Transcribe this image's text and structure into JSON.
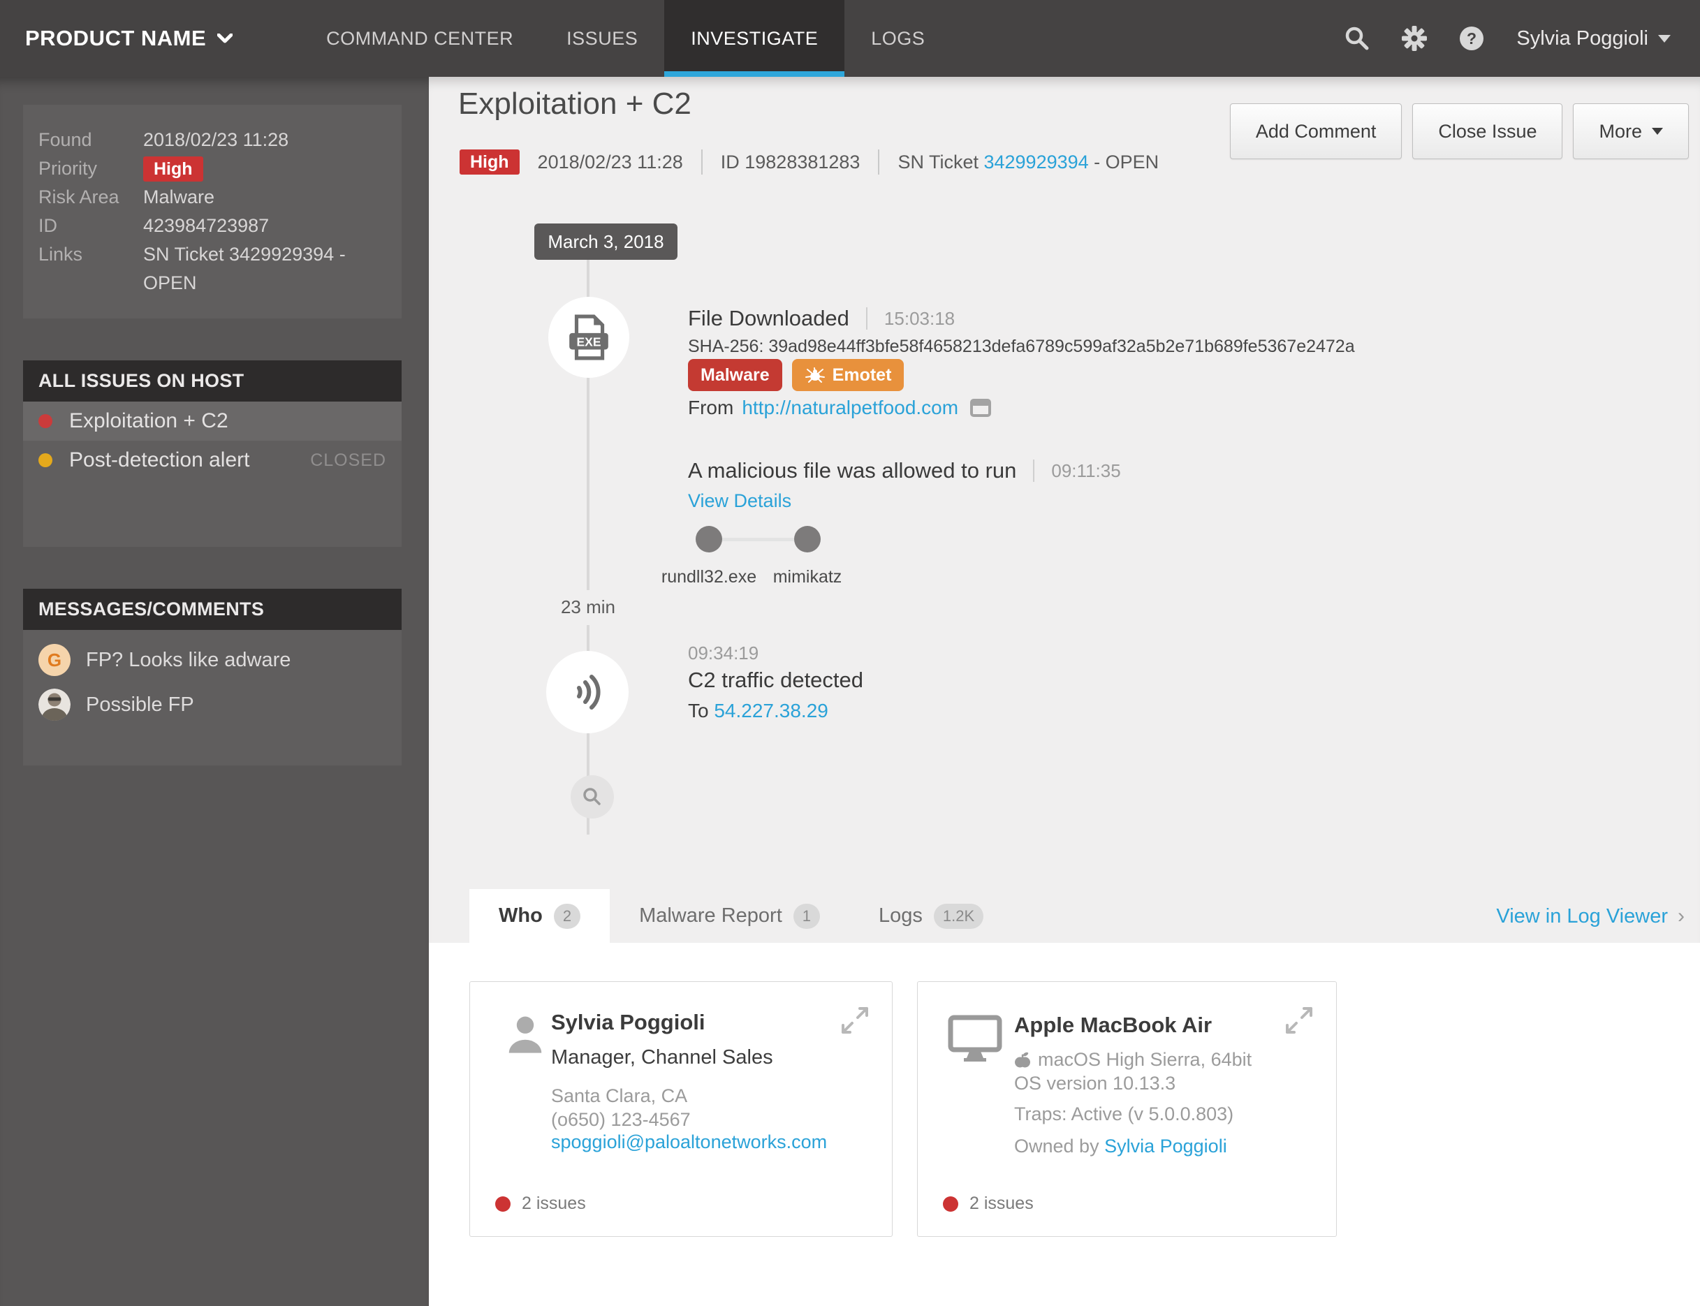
{
  "navbar": {
    "product_name": "PRODUCT NAME",
    "items": [
      {
        "label": "COMMAND CENTER"
      },
      {
        "label": "ISSUES"
      },
      {
        "label": "INVESTIGATE"
      },
      {
        "label": "LOGS"
      }
    ],
    "user_name": "Sylvia Poggioli"
  },
  "sidebar": {
    "info": {
      "rows": [
        {
          "label": "Found",
          "value": "2018/02/23 11:28"
        },
        {
          "label": "Priority",
          "value": "High"
        },
        {
          "label": "Risk Area",
          "value": "Malware"
        },
        {
          "label": "ID",
          "value": "423984723987"
        },
        {
          "label": "Links",
          "value": "SN Ticket 3429929394 - OPEN"
        }
      ]
    },
    "all_issues": {
      "title": "ALL ISSUES ON HOST",
      "items": [
        {
          "label": "Exploitation + C2",
          "status": ""
        },
        {
          "label": "Post-detection alert",
          "status": "CLOSED"
        }
      ]
    },
    "messages": {
      "title": "MESSAGES/COMMENTS",
      "items": [
        {
          "avatar": "G",
          "text": "FP? Looks like adware"
        },
        {
          "avatar": "photo",
          "text": "Possible FP"
        }
      ]
    }
  },
  "main": {
    "header": {
      "title": "Exploitation + C2",
      "priority": "High",
      "date": "2018/02/23 11:28",
      "id": "ID 19828381283",
      "sn_prefix": "SN Ticket",
      "sn_link": "3429929394",
      "sn_suffix": "- OPEN"
    },
    "actions": {
      "add_comment": "Add Comment",
      "close_issue": "Close Issue",
      "more": "More"
    },
    "timeline": {
      "date_chip": "March 3, 2018",
      "elapsed": "23 min",
      "file_downloaded": {
        "title": "File Downloaded",
        "time": "15:03:18",
        "sha": "SHA-256: 39ad98e44ff3bfe58f4658213defa6789c599af32a5b2e71b689fe5367e2472a",
        "badge_malware": "Malware",
        "badge_emotet": "Emotet",
        "from_label": "From",
        "from_url": "http://naturalpetfood.com"
      },
      "allowed_to_run": {
        "title": "A malicious file was allowed to run",
        "time": "09:11:35",
        "link": "View Details",
        "proc1": "rundll32.exe",
        "proc2": "mimikatz"
      },
      "c2": {
        "time": "09:34:19",
        "title": "C2 traffic detected",
        "to_label": "To",
        "ip": "54.227.38.29"
      }
    },
    "tabs": {
      "items": [
        {
          "label": "Who",
          "count": "2"
        },
        {
          "label": "Malware Report",
          "count": "1"
        },
        {
          "label": "Logs",
          "count": "1.2K"
        }
      ],
      "log_viewer": "View in Log Viewer"
    },
    "cards": [
      {
        "name": "Sylvia Poggioli",
        "subtitle": "Manager, Channel Sales",
        "line1": "Santa Clara, CA",
        "line2": "(o650) 123-4567",
        "email": "spoggioli@paloaltonetworks.com",
        "issues": "2 issues"
      },
      {
        "name": "Apple MacBook Air",
        "os": "macOS High Sierra, 64bit",
        "os_version": "OS version 10.13.3",
        "traps": "Traps: Active (v 5.0.0.803)",
        "owned_by": "Owned by",
        "owner": "Sylvia Poggioli",
        "issues": "2 issues"
      }
    ]
  },
  "colors": {
    "accent_blue": "#2aa2d8",
    "red": "#cc3333",
    "orange": "#e8913c",
    "yellow": "#e4a91c"
  }
}
